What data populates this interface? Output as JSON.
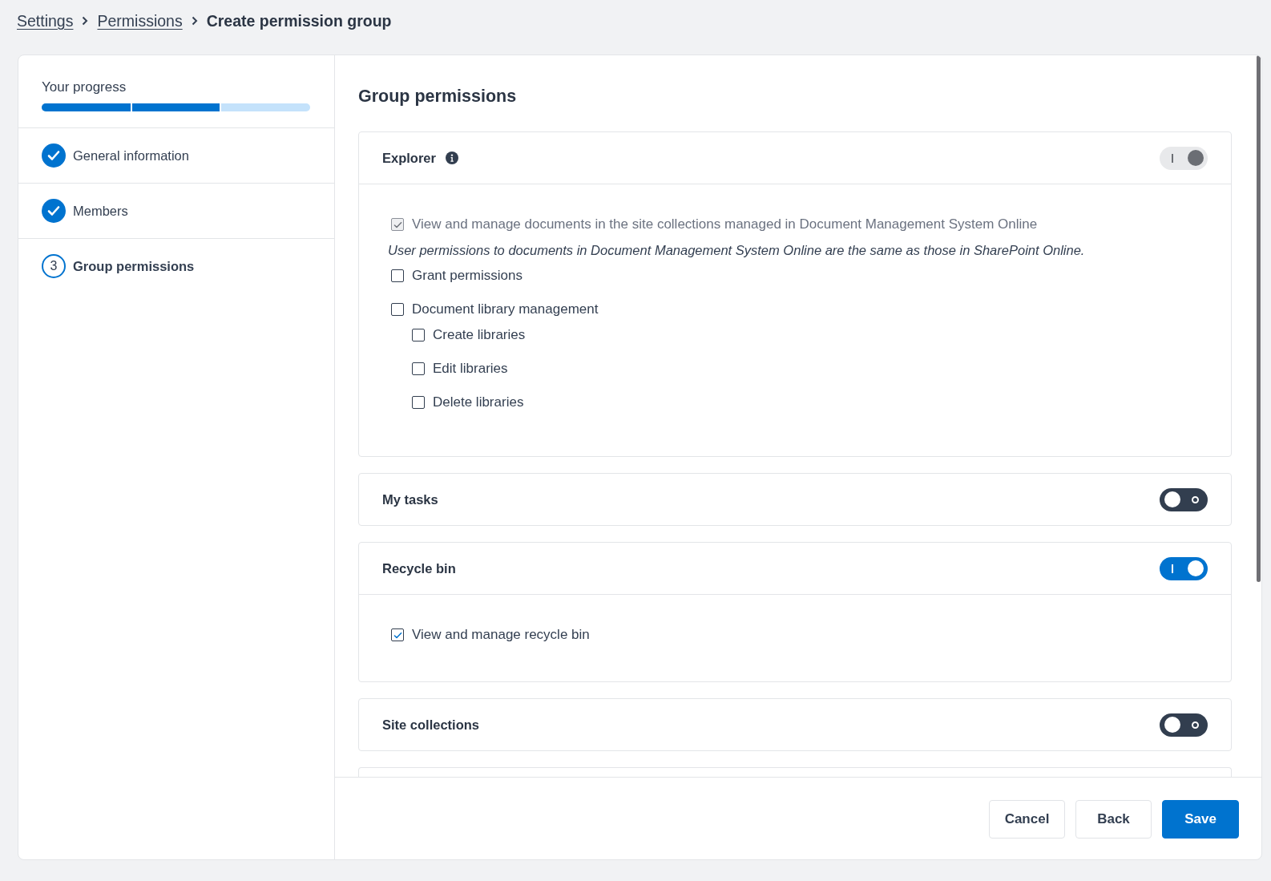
{
  "breadcrumb": [
    {
      "label": "Settings",
      "kind": "link"
    },
    {
      "label": "Permissions",
      "kind": "link"
    },
    {
      "label": "Create permission group",
      "kind": "current"
    }
  ],
  "progress": {
    "label": "Your progress",
    "level": 0.667
  },
  "steps": [
    {
      "label": "General information",
      "done": true,
      "selected": false
    },
    {
      "label": "Members",
      "done": true,
      "selected": false
    },
    {
      "label": "Group permissions",
      "done": false,
      "selected": true,
      "number": "3"
    }
  ],
  "content": {
    "title": "Group permissions"
  },
  "sections": [
    {
      "title": "Explorer",
      "info_icon": true,
      "on": true,
      "disabled": true,
      "items": [
        {
          "kind": "checkbox",
          "label": "View and manage documents in the site collections managed in Document Management System Online",
          "checked": true,
          "disabled": true
        },
        {
          "kind": "note",
          "text": "User permissions to documents in Document Management System Online are the same as those in SharePoint Online."
        },
        {
          "kind": "checkbox",
          "label": "Grant permissions",
          "checked": false,
          "disabled": false
        },
        {
          "kind": "checkbox",
          "label": "Document library management",
          "checked": false,
          "disabled": false,
          "children": [
            {
              "kind": "checkbox",
              "label": "Create libraries",
              "checked": false,
              "disabled": false
            },
            {
              "kind": "checkbox",
              "label": "Edit libraries",
              "checked": false,
              "disabled": false
            },
            {
              "kind": "checkbox",
              "label": "Delete libraries",
              "checked": false,
              "disabled": false
            }
          ]
        }
      ]
    },
    {
      "title": "My tasks",
      "info_icon": false,
      "on": false,
      "disabled": false
    },
    {
      "title": "Recycle bin",
      "info_icon": false,
      "on": true,
      "disabled": false,
      "items": [
        {
          "kind": "checkbox",
          "label": "View and manage recycle bin",
          "checked": true,
          "disabled": false
        }
      ]
    },
    {
      "title": "Site collections",
      "info_icon": false,
      "on": false,
      "disabled": false
    }
  ],
  "buttons": [
    {
      "label": "Cancel",
      "kind": "secondary"
    },
    {
      "label": "Back",
      "kind": "secondary"
    },
    {
      "label": "Save",
      "kind": "primary"
    }
  ]
}
